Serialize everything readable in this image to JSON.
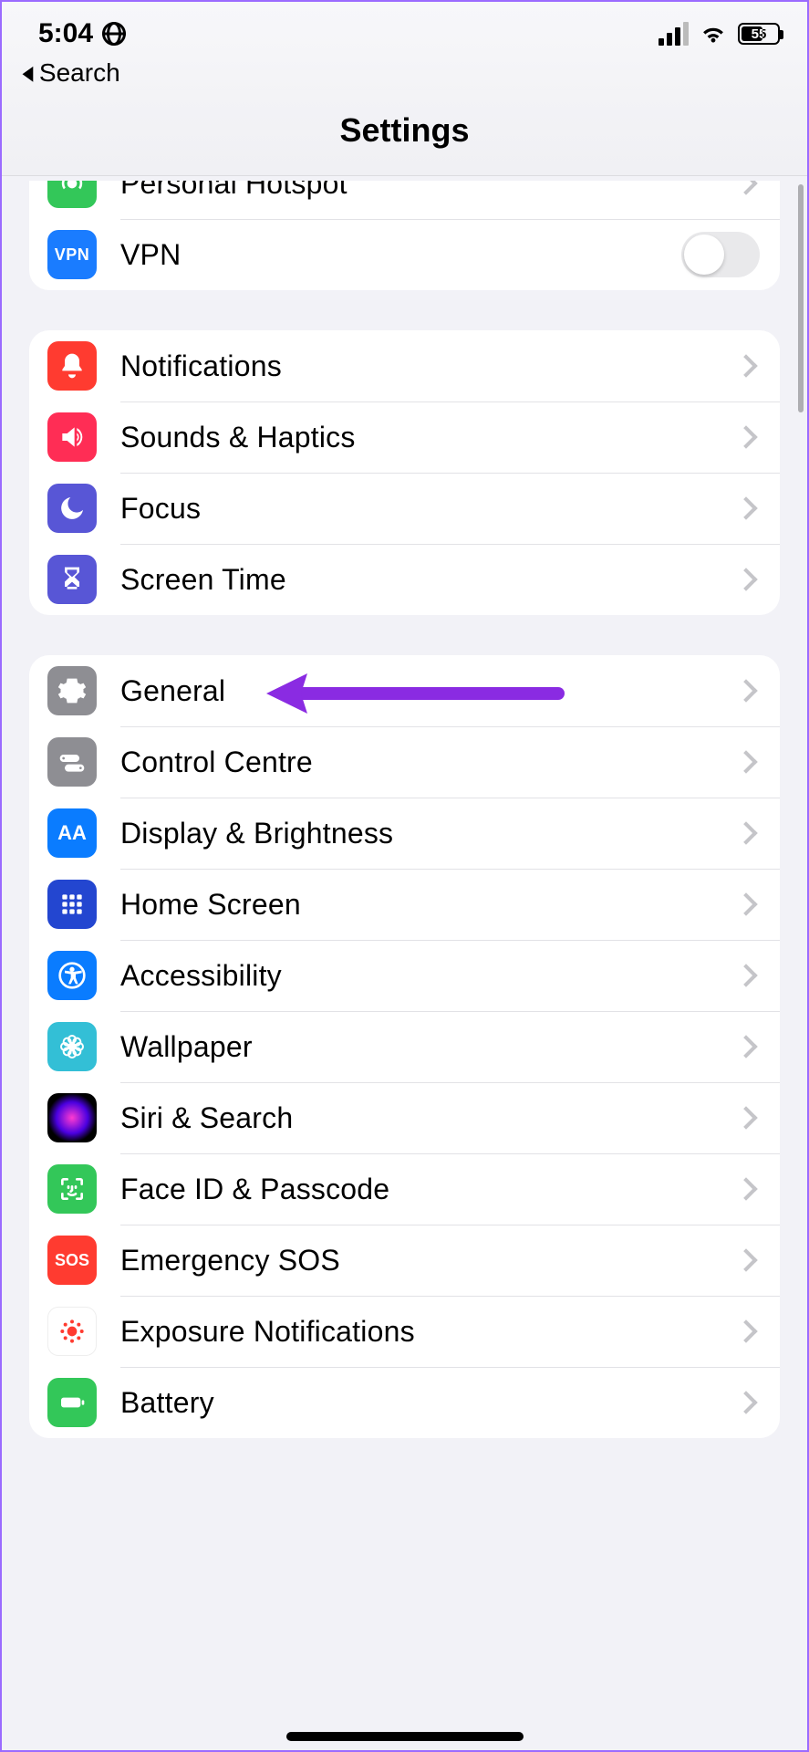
{
  "status": {
    "time": "5:04",
    "battery_pct": "55"
  },
  "nav": {
    "back_label": "Search"
  },
  "header": {
    "title": "Settings"
  },
  "groups": {
    "connectivity": {
      "hotspot": "Personal Hotspot",
      "vpn": "VPN",
      "vpn_badge": "VPN"
    },
    "alerts": {
      "notifications": "Notifications",
      "sounds": "Sounds & Haptics",
      "focus": "Focus",
      "screentime": "Screen Time"
    },
    "device": {
      "general": "General",
      "control": "Control Centre",
      "display": "Display & Brightness",
      "display_badge": "AA",
      "home": "Home Screen",
      "accessibility": "Accessibility",
      "wallpaper": "Wallpaper",
      "siri": "Siri & Search",
      "face": "Face ID & Passcode",
      "sos": "Emergency SOS",
      "sos_badge": "SOS",
      "exposure": "Exposure Notifications",
      "battery": "Battery"
    }
  },
  "annotation": {
    "target": "general-row",
    "color": "#8a2be2"
  }
}
